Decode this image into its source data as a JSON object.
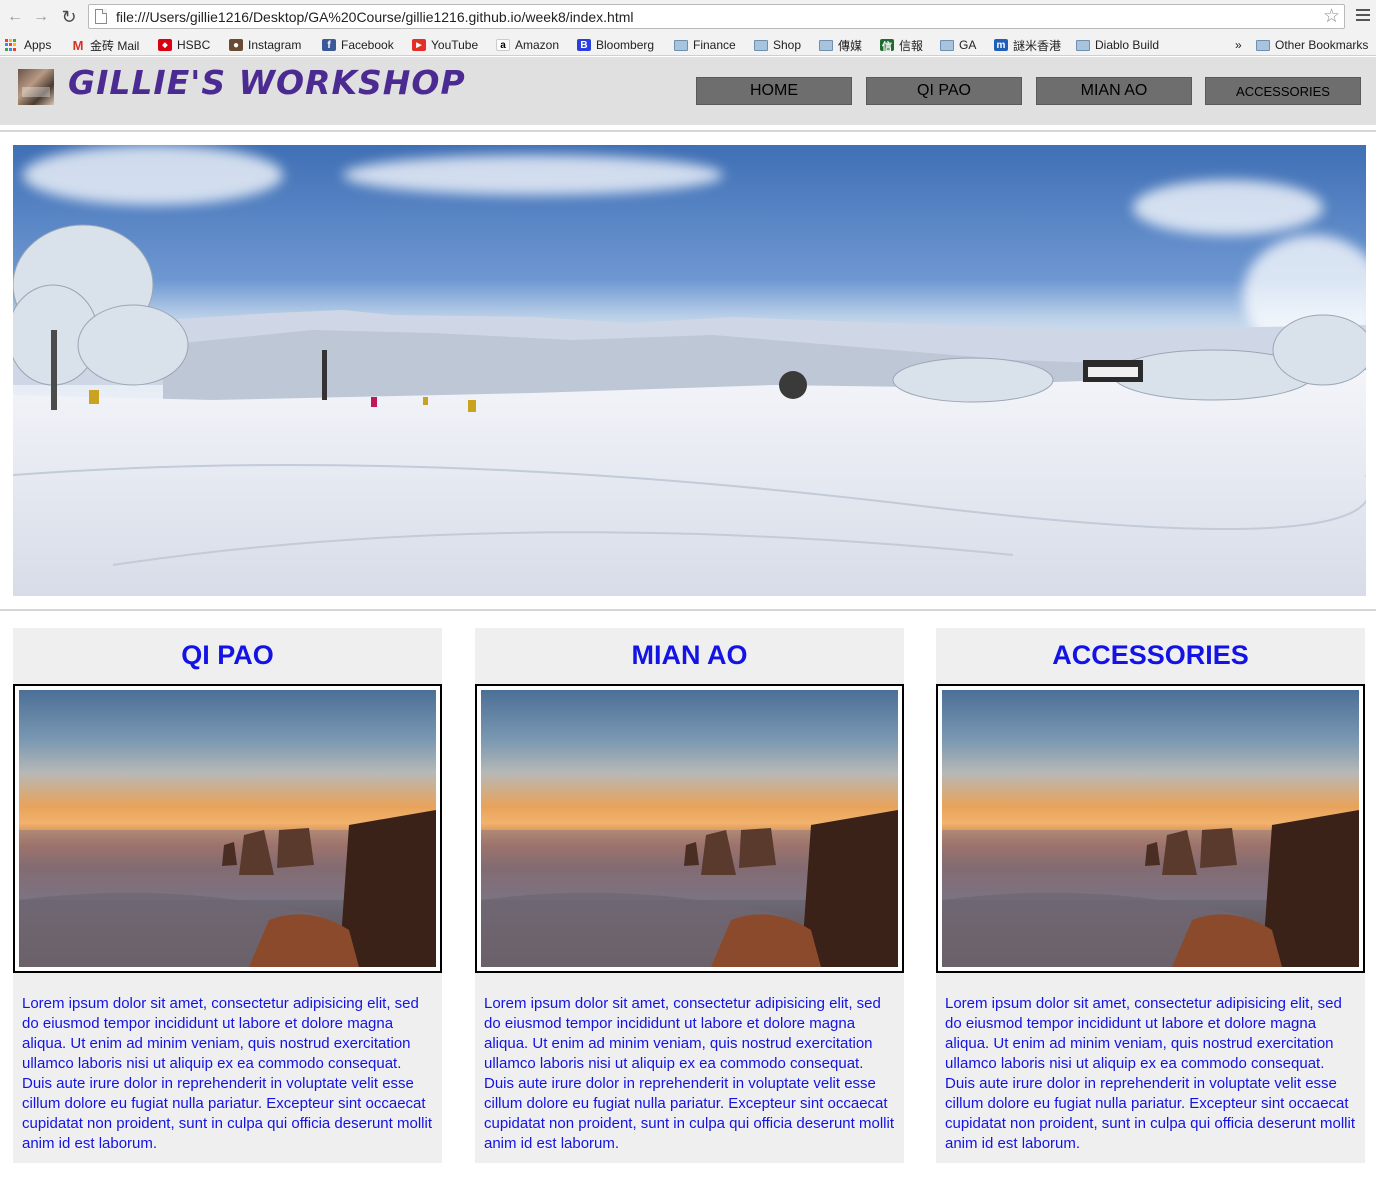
{
  "browser": {
    "url": "file:///Users/gillie1216/Desktop/GA%20Course/gillie1216.github.io/week8/index.html",
    "bookmarks": [
      {
        "label": "Apps",
        "icon": "apps-grid-icon"
      },
      {
        "label": "金砖 Mail",
        "icon": "gmail-icon"
      },
      {
        "label": "HSBC",
        "icon": "hsbc-icon"
      },
      {
        "label": "Instagram",
        "icon": "instagram-icon"
      },
      {
        "label": "Facebook",
        "icon": "facebook-icon"
      },
      {
        "label": "YouTube",
        "icon": "youtube-icon"
      },
      {
        "label": "Amazon",
        "icon": "amazon-icon"
      },
      {
        "label": "Bloomberg",
        "icon": "bloomberg-icon"
      },
      {
        "label": "Finance",
        "icon": "folder-icon"
      },
      {
        "label": "Shop",
        "icon": "folder-icon"
      },
      {
        "label": "傳媒",
        "icon": "folder-icon"
      },
      {
        "label": "信報",
        "icon": "hkej-icon"
      },
      {
        "label": "GA",
        "icon": "folder-icon"
      },
      {
        "label": "謎米香港",
        "icon": "memehk-icon"
      },
      {
        "label": "Diablo Build",
        "icon": "folder-icon"
      }
    ],
    "overflow_label": "»",
    "other_bookmarks": "Other Bookmarks"
  },
  "site": {
    "title": "GILLIE'S WORKSHOP",
    "title_color": "#4b2a91",
    "nav": [
      {
        "label": "HOME"
      },
      {
        "label": "QI PAO"
      },
      {
        "label": "MIAN AO"
      },
      {
        "label": "ACCESSORIES"
      }
    ]
  },
  "cards": [
    {
      "title": "QI PAO",
      "text": "Lorem ipsum dolor sit amet, consectetur adipisicing elit, sed do eiusmod tempor incididunt ut labore et dolore magna aliqua. Ut enim ad minim veniam, quis nostrud exercitation ullamco laboris nisi ut aliquip ex ea commodo consequat. Duis aute irure dolor in reprehenderit in voluptate velit esse cillum dolore eu fugiat nulla pariatur. Excepteur sint occaecat cupidatat non proident, sunt in culpa qui officia deserunt mollit anim id est laborum."
    },
    {
      "title": "MIAN AO",
      "text": "Lorem ipsum dolor sit amet, consectetur adipisicing elit, sed do eiusmod tempor incididunt ut labore et dolore magna aliqua. Ut enim ad minim veniam, quis nostrud exercitation ullamco laboris nisi ut aliquip ex ea commodo consequat. Duis aute irure dolor in reprehenderit in voluptate velit esse cillum dolore eu fugiat nulla pariatur. Excepteur sint occaecat cupidatat non proident, sunt in culpa qui officia deserunt mollit anim id est laborum."
    },
    {
      "title": "ACCESSORIES",
      "text": "Lorem ipsum dolor sit amet, consectetur adipisicing elit, sed do eiusmod tempor incididunt ut labore et dolore magna aliqua. Ut enim ad minim veniam, quis nostrud exercitation ullamco laboris nisi ut aliquip ex ea commodo consequat. Duis aute irure dolor in reprehenderit in voluptate velit esse cillum dolore eu fugiat nulla pariatur. Excepteur sint occaecat cupidatat non proident, sunt in culpa qui officia deserunt mollit anim id est laborum."
    }
  ],
  "colors": {
    "card_text": "#1313e6",
    "nav_bg": "#6e6e6e",
    "header_bg": "#e0e0e0",
    "card_bg": "#efefef"
  }
}
